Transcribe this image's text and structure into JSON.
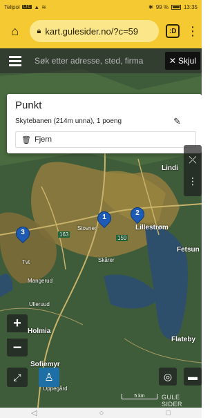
{
  "status_bar": {
    "carrier": "Telipol",
    "network": "LTE",
    "battery": "99 %",
    "time": "13:35"
  },
  "browser": {
    "url": "kart.gulesider.no/?c=59",
    "tab_count": ":D"
  },
  "map_search": {
    "placeholder": "Søk etter adresse, sted, firma",
    "hide_label": "Skjul"
  },
  "popup": {
    "title": "Punkt",
    "description": "Skytebanen (214m unna), 1 poeng",
    "remove_label": "Fjern"
  },
  "markers": [
    {
      "number": "1"
    },
    {
      "number": "2"
    },
    {
      "number": "3"
    }
  ],
  "map_labels": {
    "lindi": "Lindi",
    "lillestrom": "Lillestrøm",
    "stovner": "Stovner",
    "fetsun": "Fetsun",
    "skarer": "Skårer",
    "mangerud": "Mangerud",
    "tveita": "Tvt",
    "ulleruud": "Ulleruud",
    "holmia": "Holmia",
    "flateby": "Flateby",
    "sofiemyr": "Sofiemyr",
    "oppegard": "Oppegård",
    "road_163": "163",
    "road_159": "159"
  },
  "map_controls": {
    "zoom_in": "+",
    "zoom_out": "−",
    "scale": "5 km",
    "logo": "GULE SIDER"
  },
  "colors": {
    "accent": "#f5c932",
    "marker": "#1d5bb5",
    "map_bg": "#3f5c3a",
    "water": "#2e4f6b"
  },
  "icons": {
    "home": "home-icon",
    "lock": "lock-icon",
    "menu": "kebab-menu-icon",
    "hamburger": "hamburger-icon",
    "edit": "pencil-icon",
    "trash": "trash-icon",
    "fullscreen": "fullscreen-icon",
    "pegman": "streetview-pegman-icon",
    "locate": "locate-icon",
    "layers": "layers-icon"
  }
}
